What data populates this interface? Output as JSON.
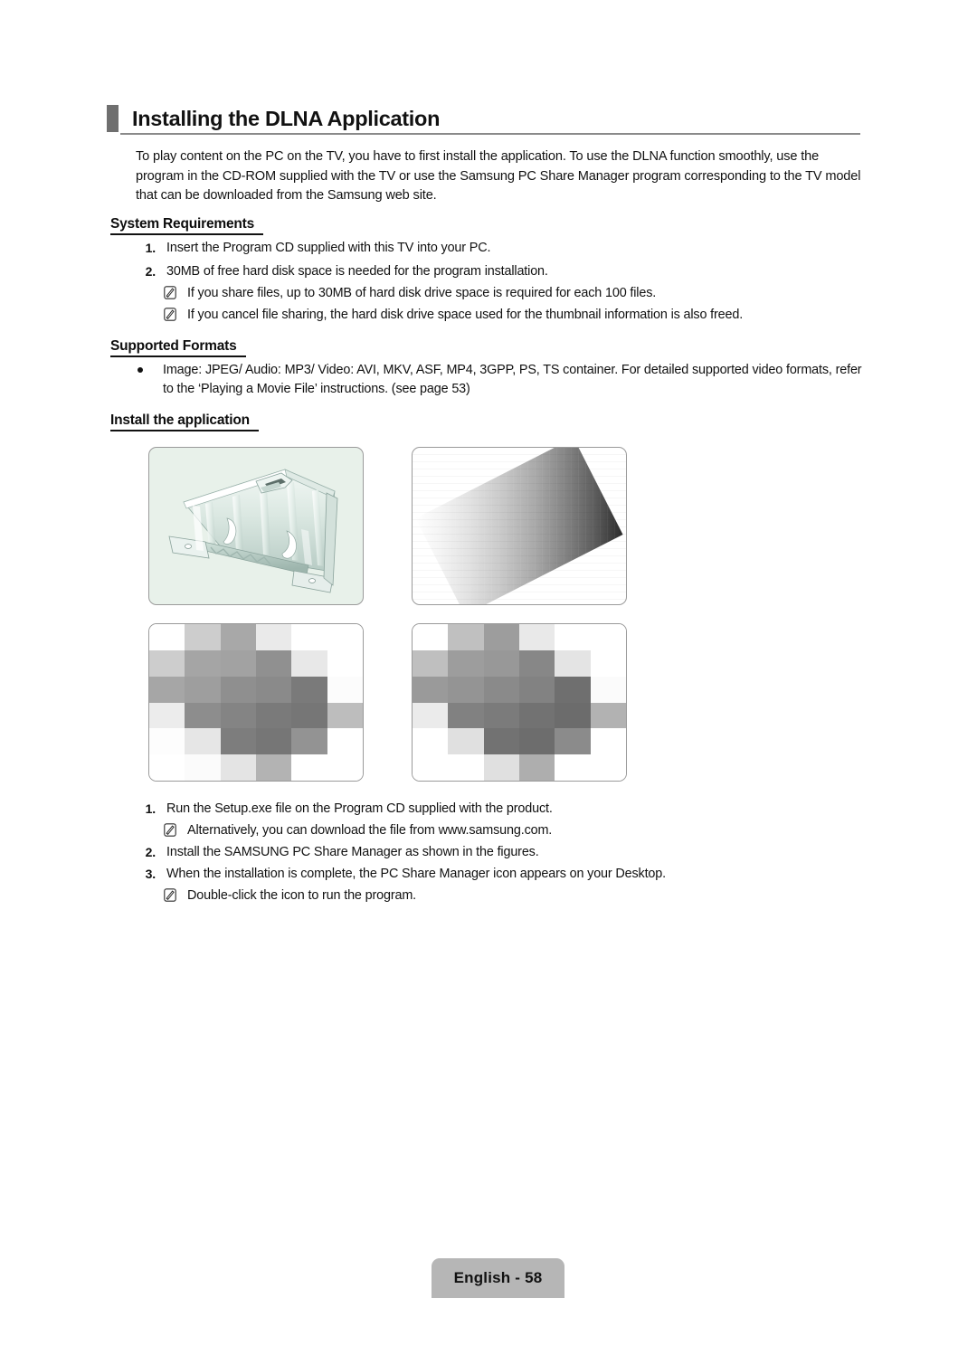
{
  "document": {
    "title": "Installing the DLNA Application",
    "intro": "To play content on the PC on the TV, you have to first install the application. To use the DLNA function smoothly, use the program in the CD-ROM supplied with the TV or use the Samsung PC Share Manager program corresponding to the TV model that can be downloaded from the Samsung web site."
  },
  "system_requirements": {
    "heading": "System Requirements",
    "items": [
      {
        "num": "1.",
        "text": "Insert the Program CD supplied with this TV into your PC."
      },
      {
        "num": "2.",
        "text": "30MB of free hard disk space is needed for the program  installation."
      }
    ],
    "notes": [
      "If you share files, up to 30MB of hard disk drive space is required for each 100 files.",
      "If you cancel file sharing, the hard disk drive space used for the thumbnail information is also freed."
    ]
  },
  "supported_formats": {
    "heading": "Supported Formats",
    "bullet": "Image: JPEG/ Audio: MP3/ Video: AVI, MKV, ASF, MP4, 3GPP, PS, TS container. For detailed supported video formats, refer to the ‘Playing a Movie File’ instructions. (see page 53)"
  },
  "install_the_application": {
    "heading": "Install the application",
    "figures": [
      {
        "name": "figure-bracket-render",
        "caption": ""
      },
      {
        "name": "figure-installer-step-1",
        "caption": ""
      },
      {
        "name": "figure-installer-step-2",
        "caption": ""
      },
      {
        "name": "figure-installer-step-3",
        "caption": ""
      }
    ],
    "steps": [
      {
        "num": "1.",
        "text": "Run the Setup.exe file on the Program CD supplied with the product."
      },
      {
        "num": "2.",
        "text": "Install the SAMSUNG PC Share Manager as shown in the figures."
      },
      {
        "num": "3.",
        "text": "When the installation is complete, the PC Share Manager icon appears on your Desktop."
      }
    ],
    "note_after_step1": "Alternatively, you can download the file from www.samsung.com.",
    "note_after_step3": "Double-click the icon to run the program."
  },
  "footer": {
    "page_label": "English - 58"
  },
  "icons": {
    "note": "note-pencil-icon",
    "title_marker": "section-marker-icon",
    "bullet": "bullet-dot-icon"
  },
  "colors": {
    "title_marker": "#6f6f6f",
    "title_rule": "#8a8a8a",
    "footer_tab": "#b6b6b6",
    "figure_border": "#9a9a9a",
    "figure1_background": "#e8f1ea",
    "text": "#111111"
  },
  "mosaic_grid": {
    "figure_3": [
      [
        "#ffffff",
        "#cdcdcd",
        "#a8a8a8",
        "#eaeaea",
        "#ffffff",
        "#ffffff"
      ],
      [
        "#cdcdcd",
        "#a5a5a5",
        "#a2a2a2",
        "#909090",
        "#e8e8e8",
        "#ffffff"
      ],
      [
        "#a6a6a6",
        "#9e9e9e",
        "#8f8f8f",
        "#8a8a8a",
        "#7a7a7a",
        "#fcfcfc"
      ],
      [
        "#ececec",
        "#8d8d8d",
        "#848484",
        "#7a7a7a",
        "#767676",
        "#bdbdbd"
      ],
      [
        "#fdfdfd",
        "#e6e6e6",
        "#7d7d7d",
        "#767676",
        "#939393",
        "#ffffff"
      ],
      [
        "#ffffff",
        "#fbfbfb",
        "#e4e4e4",
        "#b3b3b3",
        "#ffffff",
        "#ffffff"
      ]
    ],
    "figure_4": [
      [
        "#ffffff",
        "#c0c0c0",
        "#9d9d9d",
        "#e9e9e9",
        "#ffffff",
        "#ffffff"
      ],
      [
        "#bfbfbf",
        "#9d9d9d",
        "#989898",
        "#878787",
        "#e4e4e4",
        "#ffffff"
      ],
      [
        "#9a9a9a",
        "#949494",
        "#8a8a8a",
        "#828282",
        "#6f6f6f",
        "#fbfbfb"
      ],
      [
        "#ebebeb",
        "#818181",
        "#7b7b7b",
        "#727272",
        "#6c6c6c",
        "#b2b2b2"
      ],
      [
        "#ffffff",
        "#e0e0e0",
        "#727272",
        "#6d6d6d",
        "#8b8b8b",
        "#ffffff"
      ],
      [
        "#ffffff",
        "#ffffff",
        "#e0e0e0",
        "#aeaeae",
        "#ffffff",
        "#ffffff"
      ]
    ]
  }
}
